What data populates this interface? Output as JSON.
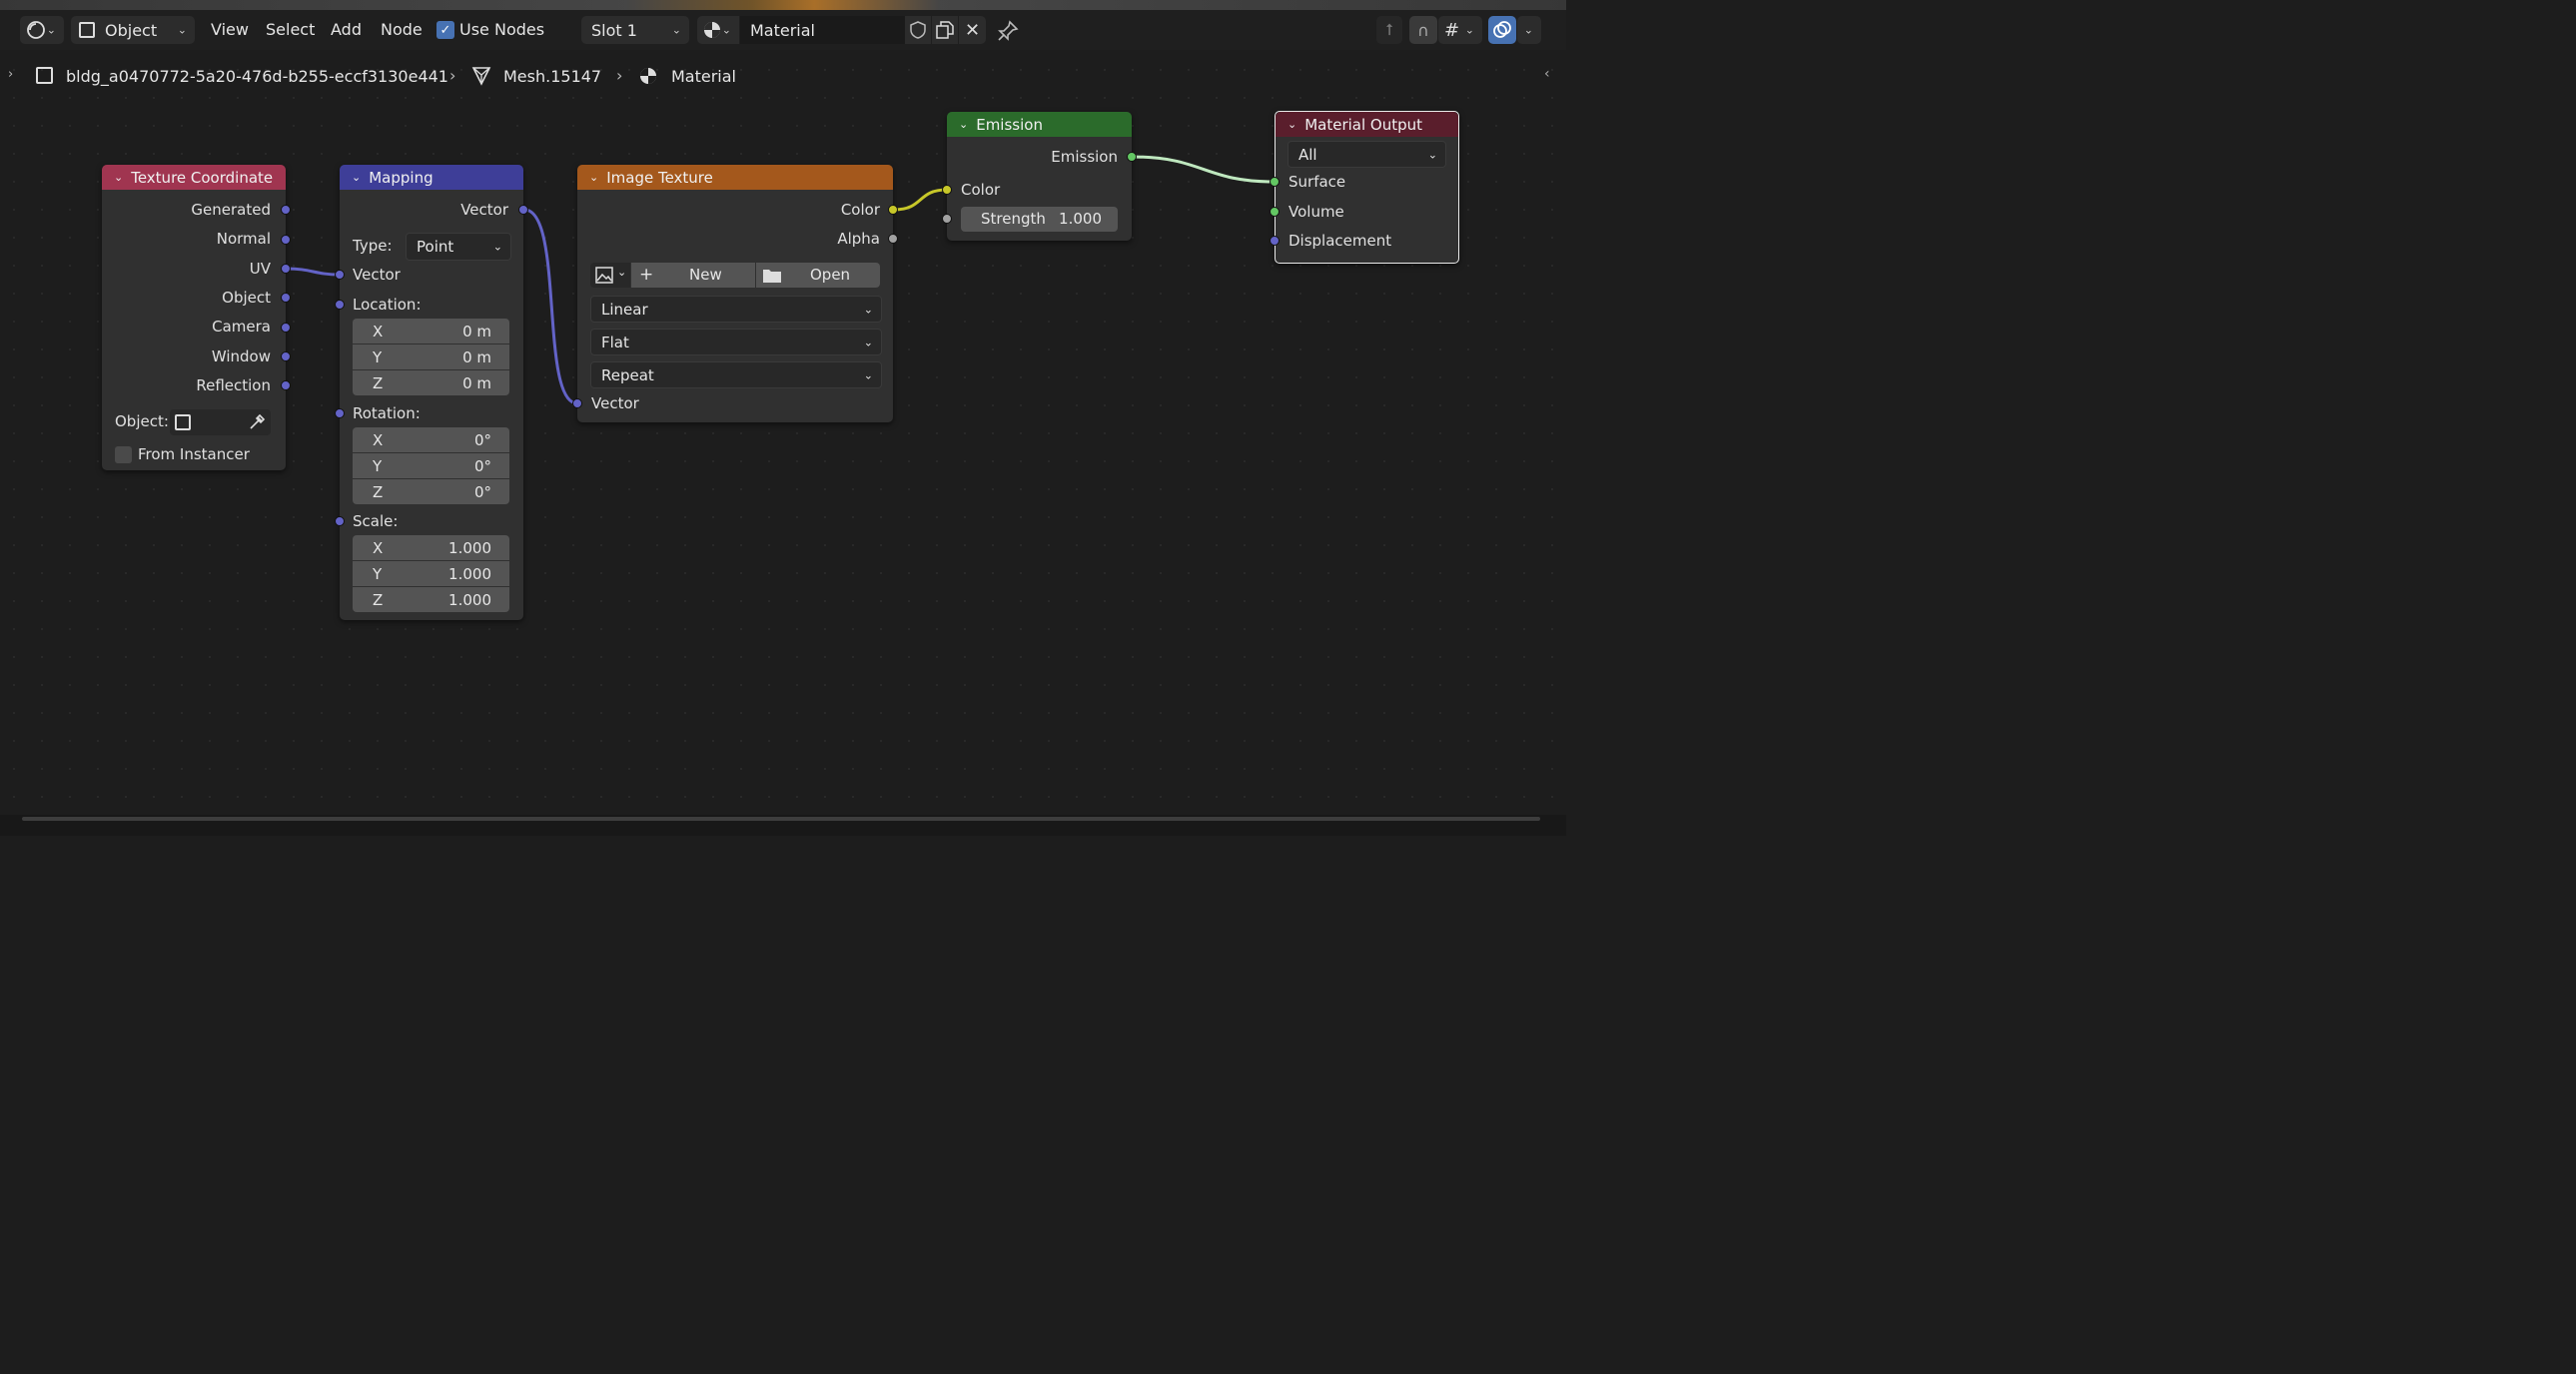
{
  "header": {
    "mode_label": "Object",
    "menus": [
      "View",
      "Select",
      "Add",
      "Node"
    ],
    "use_nodes_label": "Use Nodes",
    "slot_label": "Slot 1",
    "material_name": "Material"
  },
  "breadcrumb": {
    "object": "bldg_a0470772-5a20-476d-b255-eccf3130e441",
    "mesh": "Mesh.15147",
    "material": "Material"
  },
  "nodes": {
    "texture_coordinate": {
      "title": "Texture Coordinate",
      "outputs": [
        "Generated",
        "Normal",
        "UV",
        "Object",
        "Camera",
        "Window",
        "Reflection"
      ],
      "object_label": "Object:",
      "from_instancer_label": "From Instancer",
      "color": "#a03550"
    },
    "mapping": {
      "title": "Mapping",
      "output": "Vector",
      "type_label": "Type:",
      "type_value": "Point",
      "input_vector": "Vector",
      "location_label": "Location:",
      "location": [
        {
          "k": "X",
          "v": "0 m"
        },
        {
          "k": "Y",
          "v": "0 m"
        },
        {
          "k": "Z",
          "v": "0 m"
        }
      ],
      "rotation_label": "Rotation:",
      "rotation": [
        {
          "k": "X",
          "v": "0°"
        },
        {
          "k": "Y",
          "v": "0°"
        },
        {
          "k": "Z",
          "v": "0°"
        }
      ],
      "scale_label": "Scale:",
      "scale": [
        {
          "k": "X",
          "v": "1.000"
        },
        {
          "k": "Y",
          "v": "1.000"
        },
        {
          "k": "Z",
          "v": "1.000"
        }
      ],
      "color": "#3e3e98"
    },
    "image_texture": {
      "title": "Image Texture",
      "outputs": [
        "Color",
        "Alpha"
      ],
      "new_label": "New",
      "open_label": "Open",
      "interpolation": "Linear",
      "projection": "Flat",
      "extension": "Repeat",
      "input_vector": "Vector",
      "color": "#a4581c"
    },
    "emission": {
      "title": "Emission",
      "output": "Emission",
      "input_color": "Color",
      "strength_label": "Strength",
      "strength_value": "1.000",
      "color": "#2b6b2b"
    },
    "material_output": {
      "title": "Material Output",
      "target": "All",
      "inputs": [
        "Surface",
        "Volume",
        "Displacement"
      ],
      "color": "#5a1e2c"
    }
  },
  "colors": {
    "socket_vector": "#6363c7",
    "socket_color": "#c7c729",
    "socket_shader": "#63c763",
    "socket_float": "#a1a1a1",
    "accent": "#4772b3"
  }
}
